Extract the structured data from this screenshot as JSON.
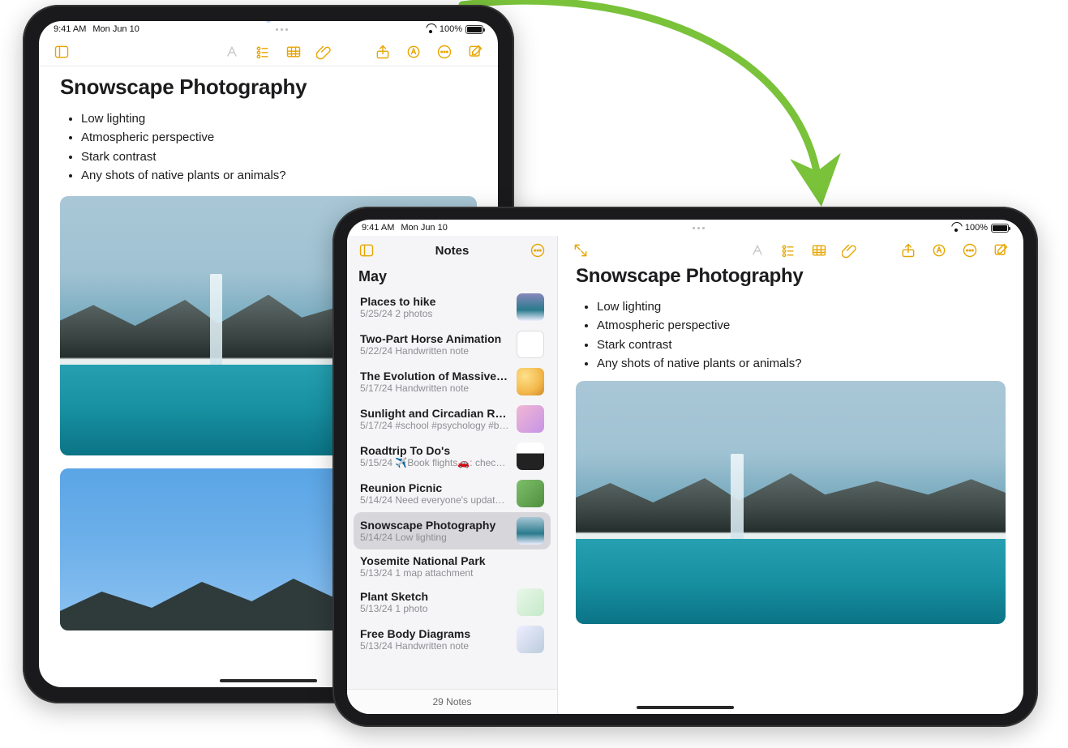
{
  "status": {
    "time": "9:41 AM",
    "date": "Mon Jun 10",
    "battery_pct": "100%"
  },
  "note": {
    "title": "Snowscape Photography",
    "bullets": [
      "Low lighting",
      "Atmospheric perspective",
      "Stark contrast",
      "Any shots of native plants or animals?"
    ]
  },
  "sidebar": {
    "title": "Notes",
    "section": "May",
    "footer": "29 Notes",
    "items": [
      {
        "title": "Places to hike",
        "date": "5/25/24",
        "sub": "2 photos",
        "thumb": "landscape-sea"
      },
      {
        "title": "Two-Part Horse Animation",
        "date": "5/22/24",
        "sub": "Handwritten note",
        "thumb": "empty"
      },
      {
        "title": "The Evolution of Massive Star…",
        "date": "5/17/24",
        "sub": "Handwritten note",
        "thumb": "star"
      },
      {
        "title": "Sunlight and Circadian Rhyth…",
        "date": "5/17/24",
        "sub": "#school #psychology #bio…",
        "thumb": "tags"
      },
      {
        "title": "Roadtrip To Do's",
        "date": "5/15/24",
        "sub": "✈️Book flights🚗: check…",
        "thumb": "road"
      },
      {
        "title": "Reunion Picnic",
        "date": "5/14/24",
        "sub": "Need everyone's updated…",
        "thumb": "picnic"
      },
      {
        "title": "Snowscape Photography",
        "date": "5/14/24",
        "sub": "Low lighting",
        "thumb": "snow",
        "selected": true
      },
      {
        "title": "Yosemite National Park",
        "date": "5/13/24",
        "sub": "1 map attachment",
        "thumb": ""
      },
      {
        "title": "Plant Sketch",
        "date": "5/13/24",
        "sub": "1 photo",
        "thumb": "plant"
      },
      {
        "title": "Free Body Diagrams",
        "date": "5/13/24",
        "sub": "Handwritten note",
        "thumb": "diagram"
      }
    ]
  },
  "colors": {
    "accent": "#E7A500",
    "arrow": "#79c23a"
  }
}
